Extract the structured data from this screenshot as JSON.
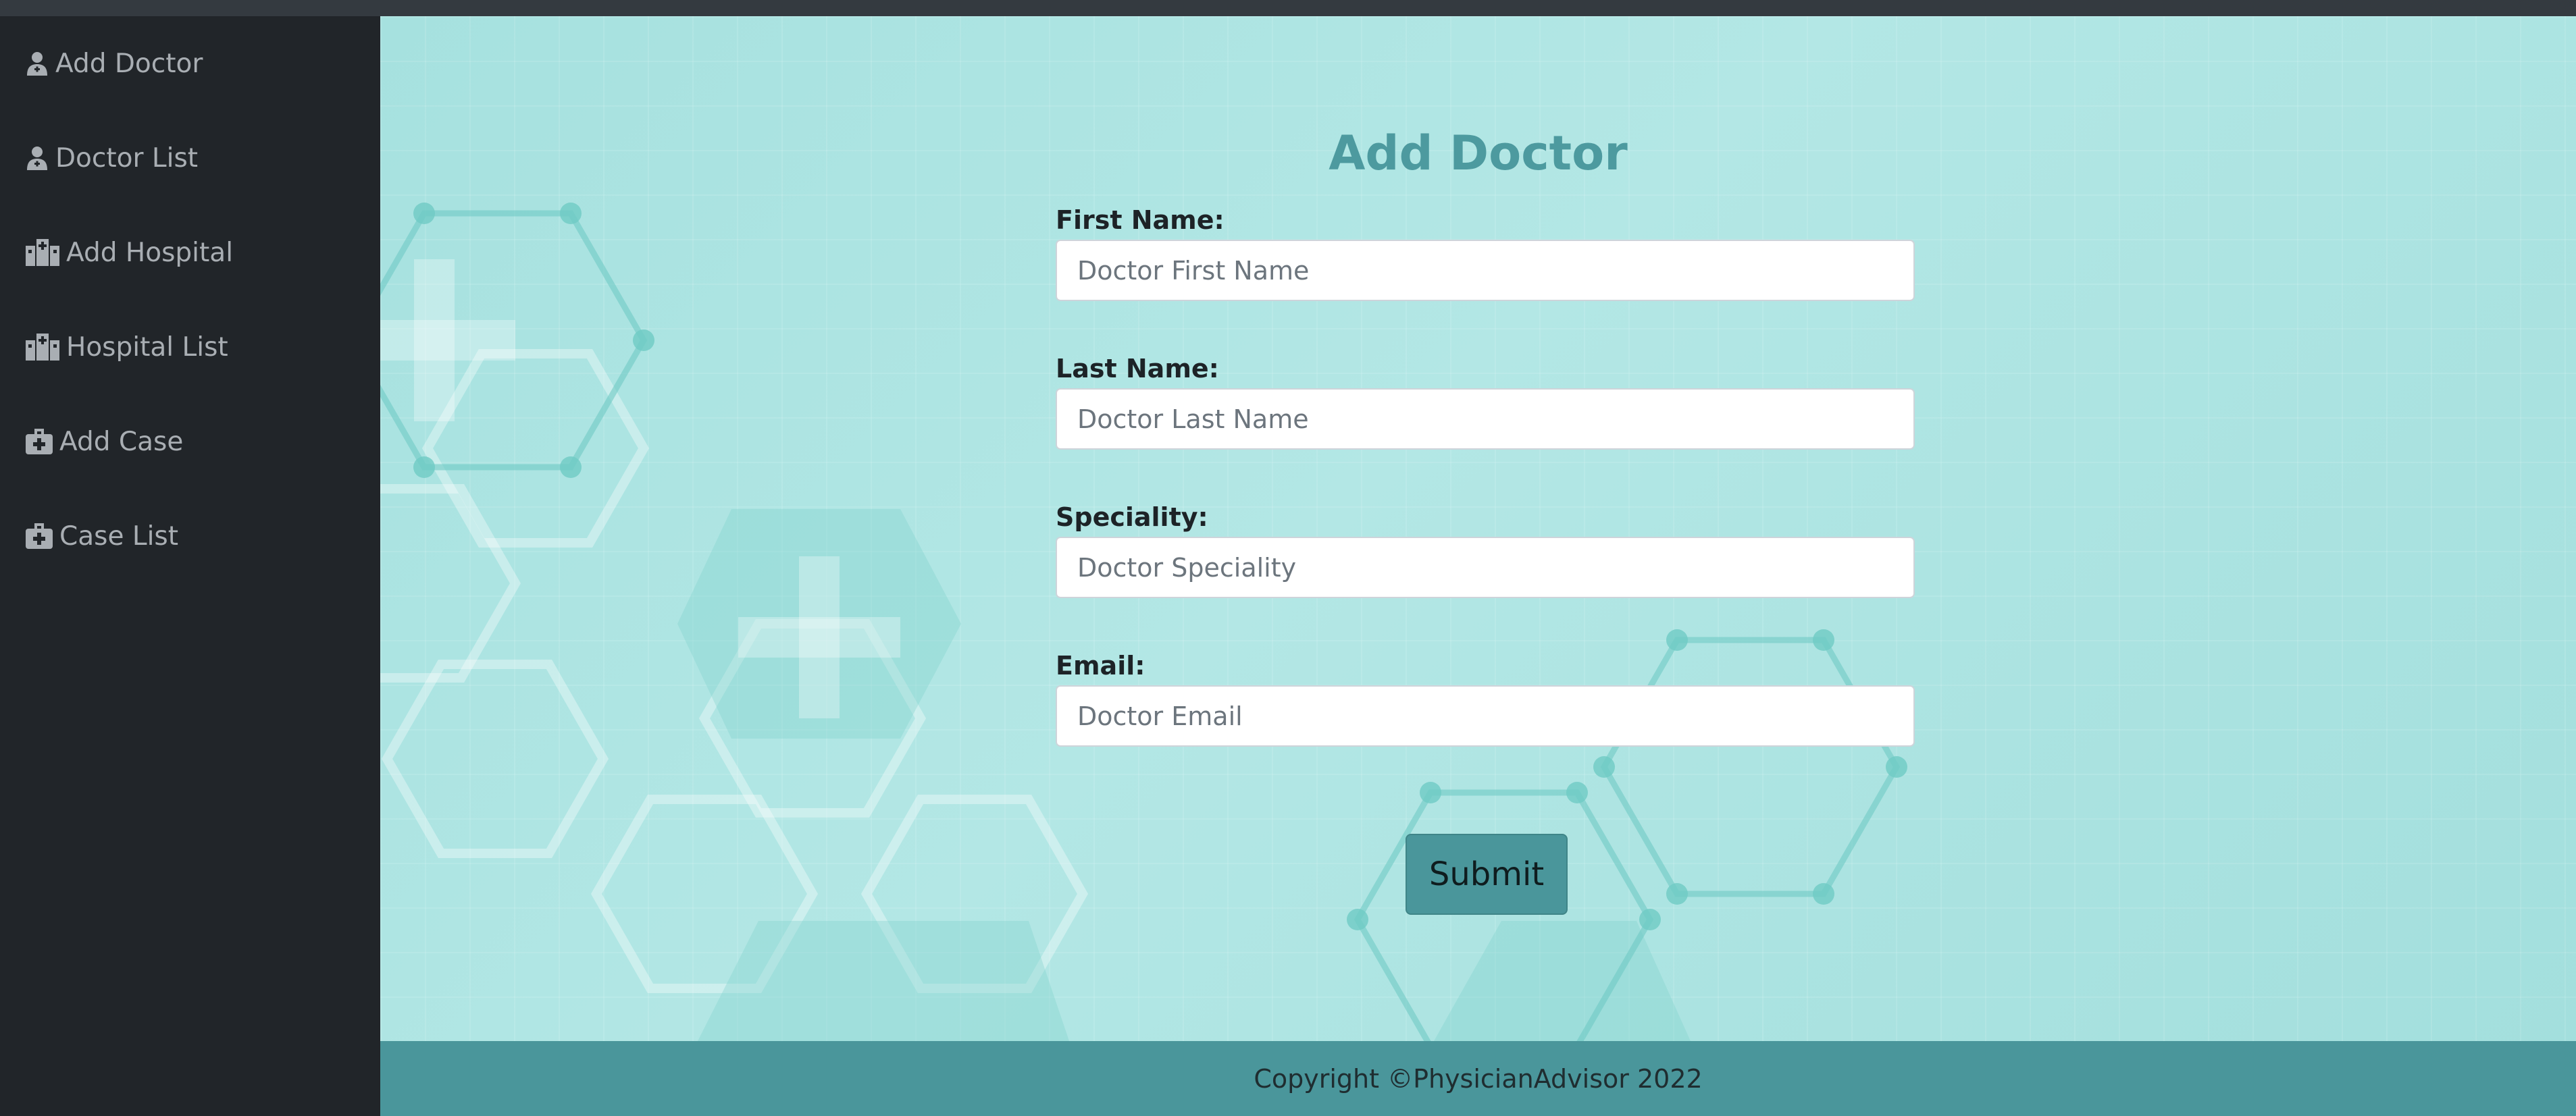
{
  "sidebar": {
    "items": [
      {
        "label": "Add Doctor",
        "icon": "doctor-icon"
      },
      {
        "label": "Doctor List",
        "icon": "doctor-icon"
      },
      {
        "label": "Add Hospital",
        "icon": "hospital-icon"
      },
      {
        "label": "Hospital List",
        "icon": "hospital-icon"
      },
      {
        "label": "Add Case",
        "icon": "medical-kit-icon"
      },
      {
        "label": "Case List",
        "icon": "medical-kit-icon"
      }
    ]
  },
  "form": {
    "title": "Add Doctor",
    "fields": [
      {
        "label": "First Name:",
        "placeholder": "Doctor First Name"
      },
      {
        "label": "Last Name:",
        "placeholder": "Doctor Last Name"
      },
      {
        "label": "Speciality:",
        "placeholder": "Doctor Speciality"
      },
      {
        "label": "Email:",
        "placeholder": "Doctor Email"
      }
    ],
    "submit_label": "Submit"
  },
  "footer": {
    "copyright": "Copyright ©PhysicianAdvisor 2022"
  },
  "colors": {
    "sidebar_bg": "#212529",
    "accent": "#4a969b",
    "title": "#4d9a9f",
    "main_bg": "#a6e1df"
  }
}
